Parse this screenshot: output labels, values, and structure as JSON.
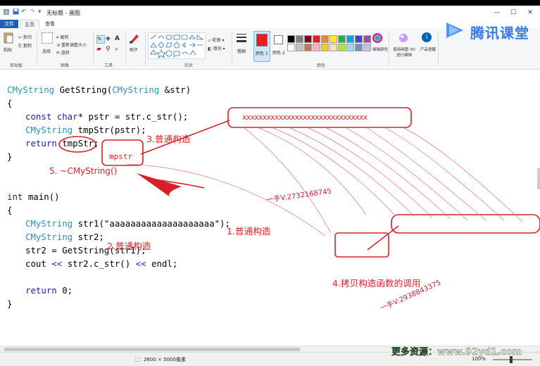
{
  "window": {
    "title": "无标题 - 画图",
    "quick_access": [
      "save-icon",
      "undo-icon",
      "redo-icon"
    ]
  },
  "tabs": {
    "file": "文件",
    "home": "主页",
    "view": "查看"
  },
  "ribbon": {
    "clipboard": {
      "paste": "粘贴",
      "cut": "剪切",
      "copy": "复制",
      "label": "剪贴板"
    },
    "image": {
      "select": "选择",
      "crop": "裁剪",
      "resize": "重新调整大小",
      "rotate": "旋转",
      "label": "图像"
    },
    "tools": {
      "label": "工具"
    },
    "brushes": {
      "label": "刷子"
    },
    "shapes": {
      "outline": "轮廓",
      "fill": "填充",
      "label": "形状"
    },
    "size": {
      "label": "粗细"
    },
    "color1": {
      "label": "颜色 1"
    },
    "color2": {
      "label": "颜色 2"
    },
    "colors": {
      "edit": "编辑颜色",
      "label": "颜色"
    },
    "paint3d": {
      "label": "使用画图 3D 进行编辑"
    },
    "product": {
      "label": "产品提醒"
    },
    "palette": [
      "#000000",
      "#7f7f7f",
      "#880015",
      "#ed1c24",
      "#ff7f27",
      "#fff200",
      "#22b14c",
      "#00a2e8",
      "#3f48cc",
      "#a349a4",
      "#ffffff",
      "#c3c3c3",
      "#b97a57",
      "#ffaec9",
      "#ffc90e",
      "#efe4b0",
      "#b5e61d",
      "#99d9ea",
      "#7092be",
      "#c8bfe7"
    ],
    "active_color": "#ed1c24"
  },
  "brand": {
    "name": "腾讯课堂",
    "color": "#2f6fd8"
  },
  "code": {
    "line1": {
      "ty": "CMyString",
      "fn": " GetString(",
      "ty2": "CMyString",
      "rest": " &str)"
    },
    "line2": "{",
    "line3": {
      "kw": "const char",
      "rest": "* pstr = str.c_str();"
    },
    "line4": {
      "ty": "CMyString",
      "rest": " tmpStr(pstr);"
    },
    "line5": {
      "kw": "return",
      "rest": " tmpStr;"
    },
    "line6": "}",
    "line7": {
      "kw": "int",
      "rest": " main()"
    },
    "line8": "{",
    "line9": {
      "ty": "CMyString",
      "rest": " str1(\"aaaaaaaaaaaaaaaaaaaa\");"
    },
    "line10": {
      "ty": "CMyString",
      "rest": " str2;"
    },
    "line11": "str2 = GetString(str1);",
    "line12": {
      "pre": "cout ",
      "op1": "<<",
      "mid": " str2.c_str() ",
      "op2": "<<",
      "post": " endl;"
    },
    "line13": {
      "kw": "return",
      "rest": " 0;"
    },
    "line14": "}"
  },
  "annotations": {
    "a3": "3.普通构造",
    "mpstr": "mpstr",
    "a5": "5. ~CMyString()",
    "xbox": "xxxxxxxxxxxxxxxxxxxxxxxxxxxxxxx",
    "a1": "1.普通构造",
    "a2": "2.普通构造",
    "a4": "4.拷贝构造函数的调用",
    "wm1": "一手V:2732168745",
    "wm2": "一手V:2938843375"
  },
  "status": {
    "dimensions": "2600 × 5000像素",
    "zoom": "100%"
  },
  "watermark_bottom": "更多资源：www.92yd1.com"
}
